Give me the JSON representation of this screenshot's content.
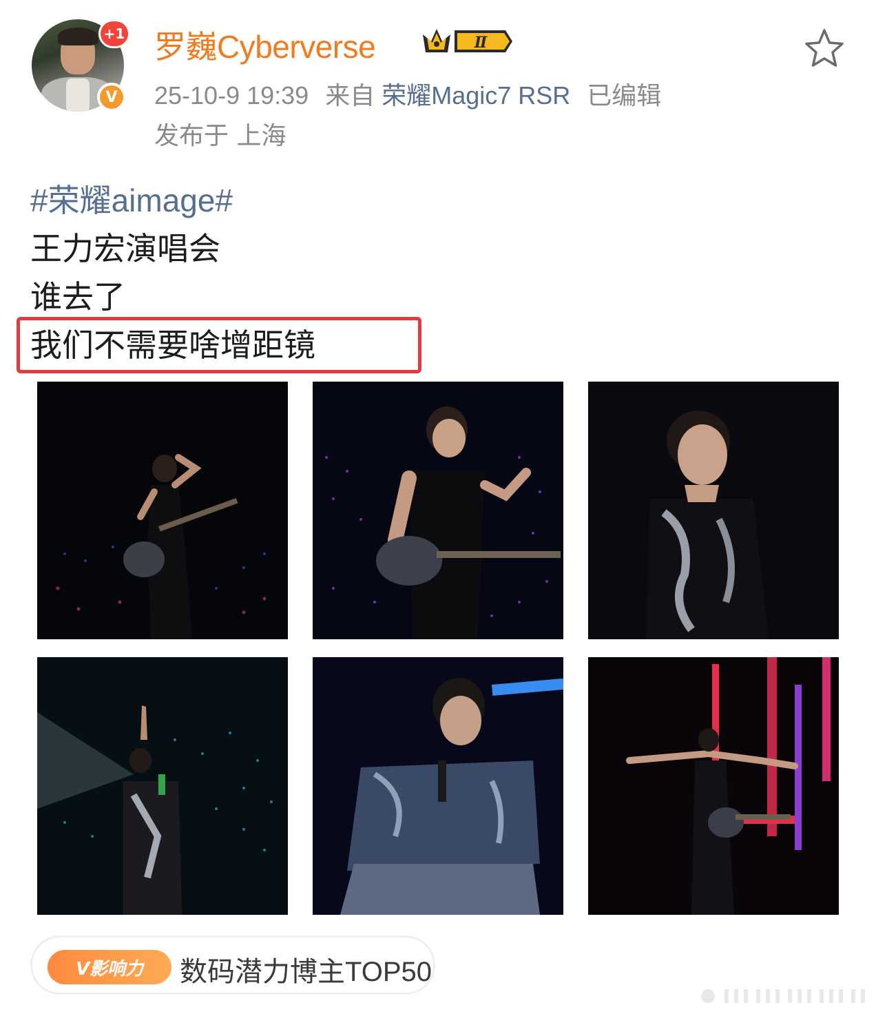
{
  "user": {
    "name": "罗巍Cyberverse",
    "notification_badge": "+1",
    "verified_mark": "V",
    "level_badge": "Ⅱ"
  },
  "meta": {
    "timestamp": "25-10-9 19:39",
    "source_prefix": "来自",
    "device": "荣耀Magic7 RSR",
    "edited": "已编辑",
    "location": "发布于 上海"
  },
  "post": {
    "hashtag": "#荣耀aimage#",
    "line1": "王力宏演唱会",
    "line2": "谁去了",
    "line3": "我们不需要啥增距镜"
  },
  "photos": [
    {
      "scene": "guitar-solo-point"
    },
    {
      "scene": "guitar-sing-close"
    },
    {
      "scene": "portrait-smile"
    },
    {
      "scene": "spotlight-point-up"
    },
    {
      "scene": "denim-jacket-sing"
    },
    {
      "scene": "arms-spread-red-stage"
    }
  ],
  "influence": {
    "tag": "V影响力",
    "rank": "数码潜力博主TOP50"
  },
  "icons": {
    "favorite": "star-outline-icon",
    "crown": "crown-icon"
  },
  "colors": {
    "username": "#f07c1f",
    "link": "#566e8f",
    "highlight": "#e23a3f",
    "meta": "#8a8a8a"
  }
}
